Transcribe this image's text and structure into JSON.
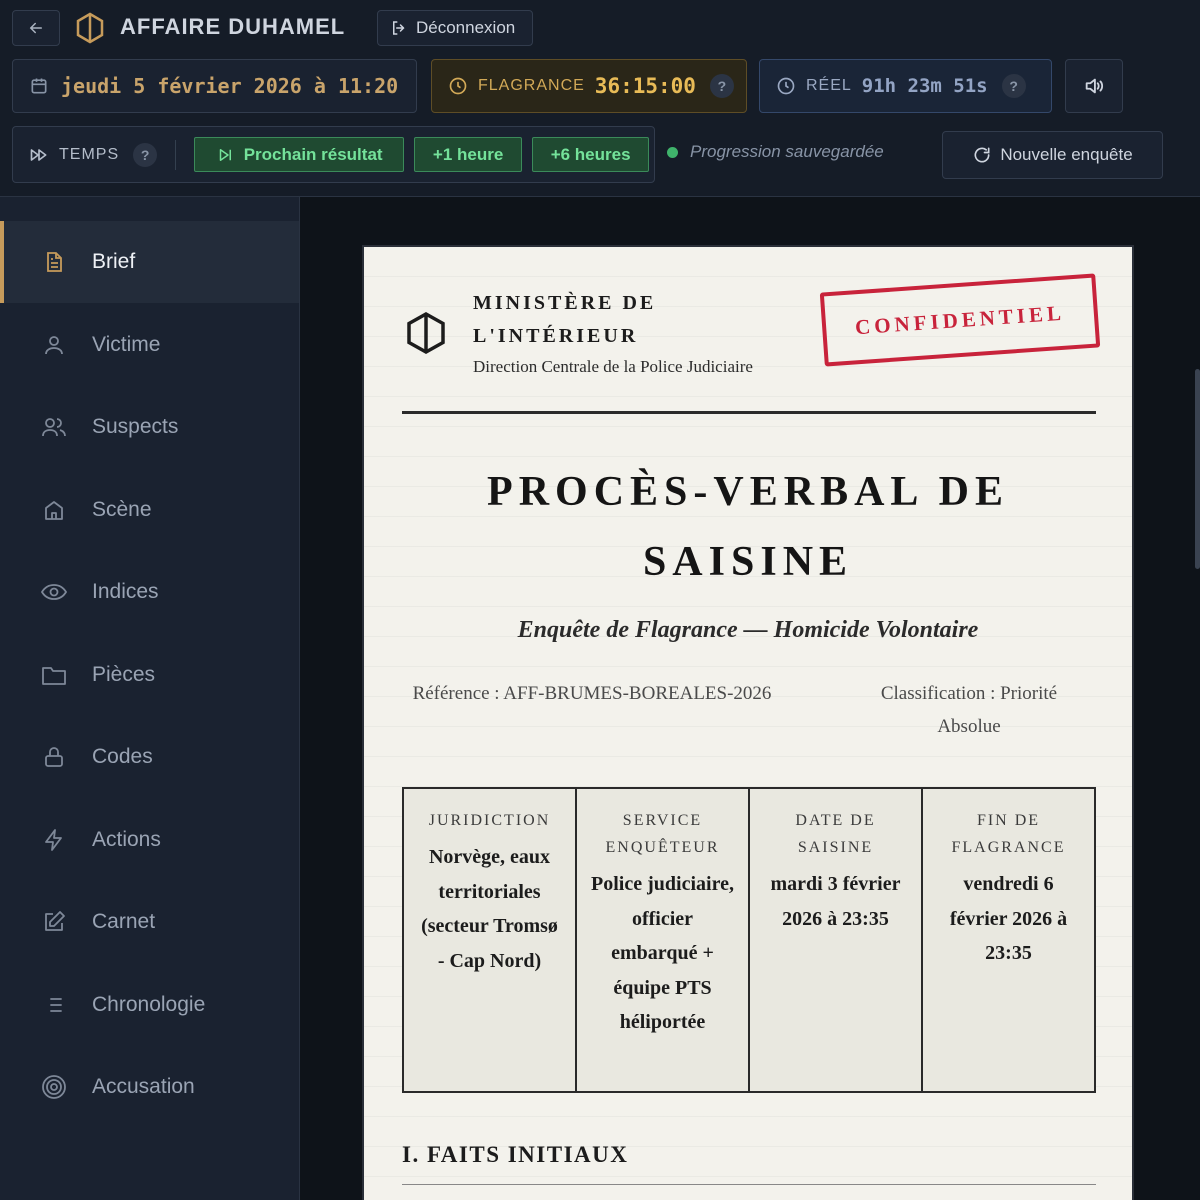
{
  "header": {
    "title": "AFFAIRE DUHAMEL",
    "logout_label": "Déconnexion",
    "date_text": "jeudi 5 février 2026 à 11:20",
    "flagrance_label": "FLAGRANCE",
    "flagrance_time": "36:15:00",
    "real_label": "RÉEL",
    "real_time": "91h 23m 51s",
    "help": "?",
    "time_label": "TEMPS",
    "next_result_label": "Prochain résultat",
    "plus_1h_label": "+1 heure",
    "plus_6h_label": "+6 heures",
    "saved_text": "Progression sauvegardée",
    "new_investigation_label": "Nouvelle enquête"
  },
  "sidebar": {
    "items": [
      {
        "label": "Brief",
        "icon": "document-icon",
        "active": true
      },
      {
        "label": "Victime",
        "icon": "user-icon"
      },
      {
        "label": "Suspects",
        "icon": "users-icon"
      },
      {
        "label": "Scène",
        "icon": "home-icon"
      },
      {
        "label": "Indices",
        "icon": "eye-icon"
      },
      {
        "label": "Pièces",
        "icon": "folder-icon"
      },
      {
        "label": "Codes",
        "icon": "lock-icon"
      },
      {
        "label": "Actions",
        "icon": "bolt-icon"
      },
      {
        "label": "Carnet",
        "icon": "edit-icon"
      },
      {
        "label": "Chronologie",
        "icon": "list-icon"
      },
      {
        "label": "Accusation",
        "icon": "target-icon"
      }
    ]
  },
  "document": {
    "ministry_line1": "MINISTÈRE DE",
    "ministry_line2": "L'INTÉRIEUR",
    "ministry_sub": "Direction Centrale de la Police Judiciaire",
    "stamp": "CONFIDENTIEL",
    "title_line1": "PROCÈS-VERBAL DE",
    "title_line2": "SAISINE",
    "subtitle": "Enquête de Flagrance — Homicide Volontaire",
    "reference": "Référence : AFF-BRUMES-BOREALES-2026",
    "classification": "Classification : Priorité Absolue",
    "table": [
      {
        "head": "JURIDICTION",
        "value": "Norvège, eaux territoriales (secteur Tromsø - Cap Nord)"
      },
      {
        "head": "SERVICE ENQUÊTEUR",
        "value": "Police judiciaire, officier embarqué + équipe PTS héliportée"
      },
      {
        "head": "DATE DE SAISINE",
        "value": "mardi 3 février 2026 à 23:35"
      },
      {
        "head": "FIN DE FLAGRANCE",
        "value": "vendredi 6 février 2026 à 23:35"
      }
    ],
    "section_1": "I. FAITS INITIAUX"
  },
  "colors": {
    "accent": "#c69b5b",
    "green": "#74e29a",
    "stamp_red": "#c8233b"
  }
}
